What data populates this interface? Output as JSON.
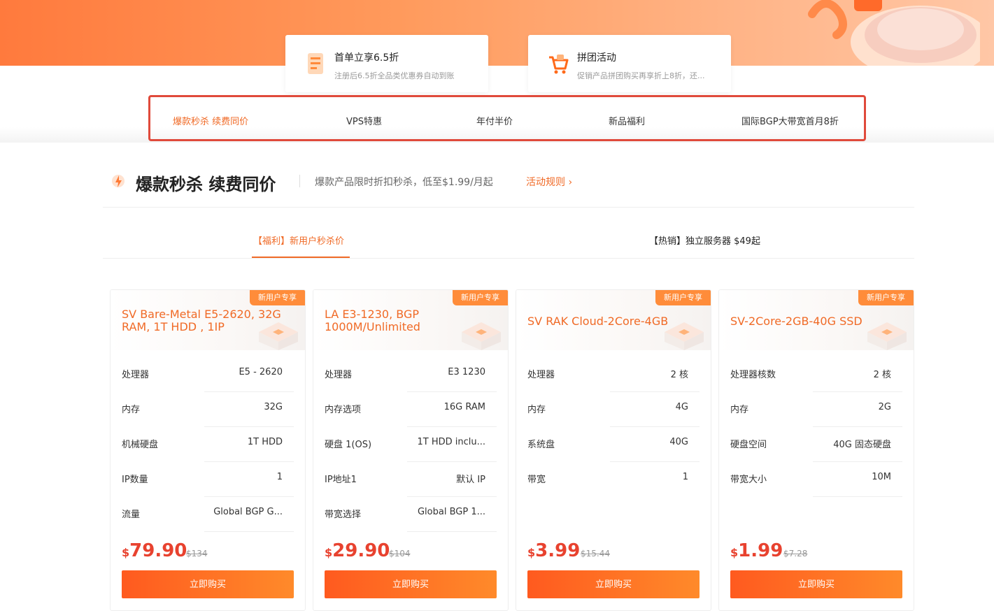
{
  "promos": [
    {
      "title": "首单立享6.5折",
      "desc": "注册后6.5折全品类优惠券自动到账"
    },
    {
      "title": "拼团活动",
      "desc": "促销产品拼团购买再享折上8折，还..."
    }
  ],
  "nav": [
    "爆款秒杀 续费同价",
    "VPS特惠",
    "年付半价",
    "新品福利",
    "国际BGP大带宽首月8折"
  ],
  "section": {
    "title": "爆款秒杀 续费同价",
    "subtitle": "爆款产品限时折扣秒杀，低至$1.99/月起",
    "link": "活动规则 ›"
  },
  "tabs": [
    "【福利】新用户秒杀价",
    "【热销】独立服务器 $49起"
  ],
  "cards": [
    {
      "badge": "新用户专享",
      "title": "SV Bare-Metal E5-2620, 32G RAM, 1T HDD , 1IP",
      "specs": [
        {
          "k": "处理器",
          "v": "E5 - 2620"
        },
        {
          "k": "内存",
          "v": "32G"
        },
        {
          "k": "机械硬盘",
          "v": "1T HDD"
        },
        {
          "k": "IP数量",
          "v": "1"
        },
        {
          "k": "流量",
          "v": "Global BGP G..."
        }
      ],
      "price_currency": "$",
      "price": "79.90",
      "original": "$134",
      "buy": "立即购买"
    },
    {
      "badge": "新用户专享",
      "title": "LA E3-1230, BGP 1000M/Unlimited",
      "specs": [
        {
          "k": "处理器",
          "v": "E3 1230"
        },
        {
          "k": "内存选项",
          "v": "16G RAM"
        },
        {
          "k": "硬盘 1(OS)",
          "v": "1T HDD inclu..."
        },
        {
          "k": "IP地址1",
          "v": "默认 IP"
        },
        {
          "k": "带宽选择",
          "v": "Global BGP 1..."
        }
      ],
      "price_currency": "$",
      "price": "29.90",
      "original": "$104",
      "buy": "立即购买"
    },
    {
      "badge": "新用户专享",
      "title": "SV RAK Cloud-2Core-4GB",
      "specs": [
        {
          "k": "处理器",
          "v": "2 核"
        },
        {
          "k": "内存",
          "v": "4G"
        },
        {
          "k": "系统盘",
          "v": "40G"
        },
        {
          "k": "带宽",
          "v": "1"
        }
      ],
      "price_currency": "$",
      "price": "3.99",
      "original": "$15.44",
      "buy": "立即购买"
    },
    {
      "badge": "新用户专享",
      "title": "SV-2Core-2GB-40G SSD",
      "specs": [
        {
          "k": "处理器核数",
          "v": "2 核"
        },
        {
          "k": "内存",
          "v": "2G"
        },
        {
          "k": "硬盘空间",
          "v": "40G 固态硬盘"
        },
        {
          "k": "带宽大小",
          "v": "10M"
        }
      ],
      "price_currency": "$",
      "price": "1.99",
      "original": "$7.28",
      "buy": "立即购买"
    }
  ],
  "colors": {
    "accent": "#f06a26",
    "price": "#e8422f",
    "nav_border": "#e04a3b"
  }
}
